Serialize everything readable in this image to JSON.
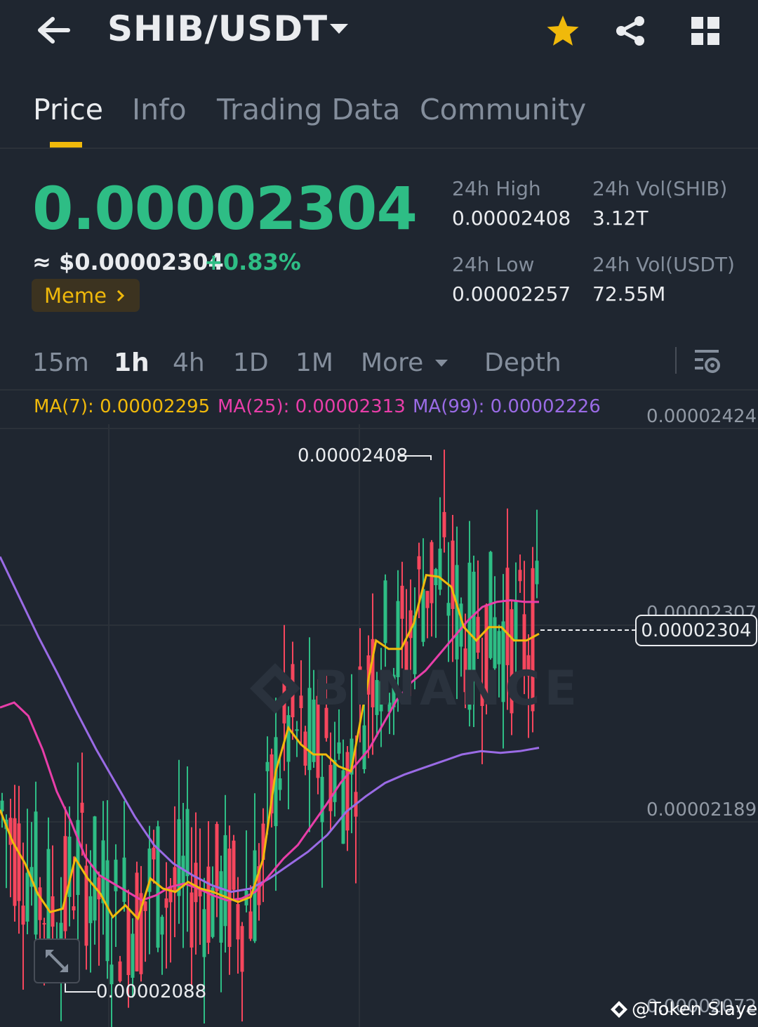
{
  "header": {
    "back_icon": "arrow-left-icon",
    "pair": "SHIB/USDT",
    "favorite_color": "#f0b90b"
  },
  "tabs": [
    {
      "label": "Price",
      "active": true
    },
    {
      "label": "Info",
      "active": false
    },
    {
      "label": "Trading Data",
      "active": false
    },
    {
      "label": "Community",
      "active": false
    }
  ],
  "price": {
    "last": "0.00002304",
    "fiat": "≈ $0.00002304",
    "change": "+0.83%",
    "tag": "Meme"
  },
  "stats": {
    "high_label": "24h High",
    "high_value": "0.00002408",
    "low_label": "24h Low",
    "low_value": "0.00002257",
    "vol_base_label": "24h Vol(SHIB)",
    "vol_base_value": "3.12T",
    "vol_quote_label": "24h Vol(USDT)",
    "vol_quote_value": "72.55M"
  },
  "intervals": {
    "items": [
      "15m",
      "1h",
      "4h",
      "1D",
      "1M"
    ],
    "active": "1h",
    "more": "More",
    "depth": "Depth"
  },
  "ma": {
    "ma7": "MA(7): 0.00002295",
    "ma25": "MA(25): 0.00002313",
    "ma99": "MA(99): 0.00002226",
    "ma7_color": "#f0b90b",
    "ma25_color": "#e83ea9",
    "ma99_color": "#9a6be5"
  },
  "chart_data": {
    "type": "candlestick",
    "interval": "1h",
    "y_axis_labels": [
      "0.00002424",
      "0.00002307",
      "0.00002189",
      "0.00002072"
    ],
    "ylim": [
      2.072e-05,
      2.424e-05
    ],
    "current_price": "0.00002304",
    "period_high": "0.00002408",
    "period_low": "0.00002088",
    "up_color": "#2ebd85",
    "down_color": "#f6465d",
    "ma7_values": [
      2.189,
      2.17,
      2.157,
      2.139,
      2.128,
      2.13,
      2.16,
      2.148,
      2.139,
      2.125,
      2.132,
      2.124,
      2.148,
      2.142,
      2.14,
      2.146,
      2.142,
      2.14,
      2.137,
      2.134,
      2.137,
      2.16,
      2.212,
      2.238,
      2.228,
      2.222,
      2.222,
      2.215,
      2.212,
      2.252,
      2.29,
      2.285,
      2.285,
      2.3,
      2.329,
      2.328,
      2.322,
      2.298,
      2.29,
      2.298,
      2.298,
      2.29,
      2.29,
      2.294
    ],
    "ma25_values": [
      2.25,
      2.253,
      2.245,
      2.225,
      2.2,
      2.182,
      2.161,
      2.15,
      2.145,
      2.14,
      2.135,
      2.138,
      2.143,
      2.145,
      2.142,
      2.138,
      2.135,
      2.136,
      2.14,
      2.15,
      2.16,
      2.168,
      2.18,
      2.192,
      2.205,
      2.215,
      2.225,
      2.24,
      2.255,
      2.265,
      2.272,
      2.282,
      2.292,
      2.302,
      2.31,
      2.313,
      2.314,
      2.313,
      2.313
    ],
    "ma99_values": [
      2.34,
      2.316,
      2.292,
      2.27,
      2.247,
      2.225,
      2.205,
      2.185,
      2.168,
      2.157,
      2.15,
      2.144,
      2.14,
      2.142,
      2.148,
      2.156,
      2.164,
      2.174,
      2.188,
      2.197,
      2.205,
      2.21,
      2.214,
      2.218,
      2.222,
      2.224,
      2.223,
      2.224,
      2.226
    ],
    "ma_value_scale": "1e-5"
  },
  "watermark": "BINANCE",
  "credit": "@Token Slayer"
}
